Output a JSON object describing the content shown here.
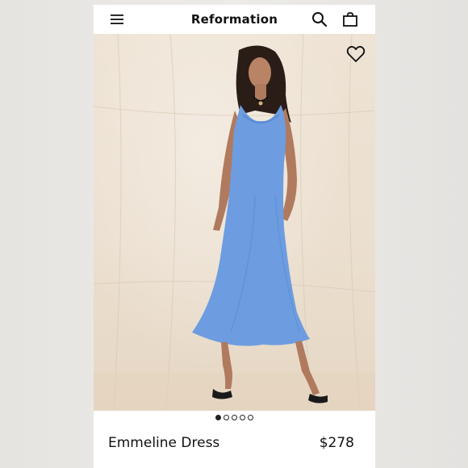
{
  "header": {
    "brand": "Reformation",
    "menu_icon": "hamburger-menu-icon",
    "search_icon": "search-icon",
    "bag_icon": "shopping-bag-icon"
  },
  "product": {
    "name": "Emmeline Dress",
    "price": "$278",
    "wishlist_icon": "heart-icon",
    "dress_color": "#6d9de0",
    "image_pagination": {
      "total": 5,
      "current": 1
    }
  }
}
